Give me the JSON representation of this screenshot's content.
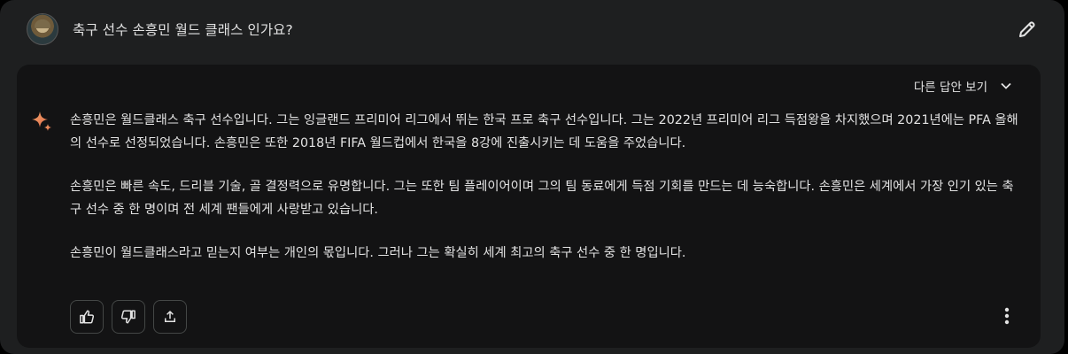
{
  "prompt": {
    "text": "축구 선수 손흥민 월드 클래스 인가요?",
    "avatar_icon": "user-avatar",
    "edit_icon": "pencil-icon"
  },
  "response": {
    "drafts_label": "다른 답안 보기",
    "paragraphs": [
      "손흥민은 월드클래스 축구 선수입니다. 그는 잉글랜드 프리미어 리그에서 뛰는 한국 프로 축구 선수입니다. 그는 2022년 프리미어 리그 득점왕을 차지했으며 2021년에는 PFA 올해의 선수로 선정되었습니다. 손흥민은 또한 2018년 FIFA 월드컵에서 한국을 8강에 진출시키는 데 도움을 주었습니다.",
      "손흥민은 빠른 속도, 드리블 기술, 골 결정력으로 유명합니다. 그는 또한 팀 플레이어이며 그의 팀 동료에게 득점 기회를 만드는 데 능숙합니다. 손흥민은 세계에서 가장 인기 있는 축구 선수 중 한 명이며 전 세계 팬들에게 사랑받고 있습니다.",
      "손흥민이 월드클래스라고 믿는지 여부는 개인의 몫입니다. 그러나 그는 확실히 세계 최고의 축구 선수 중 한 명입니다."
    ],
    "action_icons": [
      "thumb-up-icon",
      "thumb-down-icon",
      "share-icon",
      "more-vert-icon"
    ]
  },
  "colors": {
    "background": "#1e1f20",
    "card": "#131314",
    "text": "#e3e3e3",
    "border": "#444746",
    "sparkle_start": "#f2a56b",
    "sparkle_end": "#e06b4a"
  }
}
